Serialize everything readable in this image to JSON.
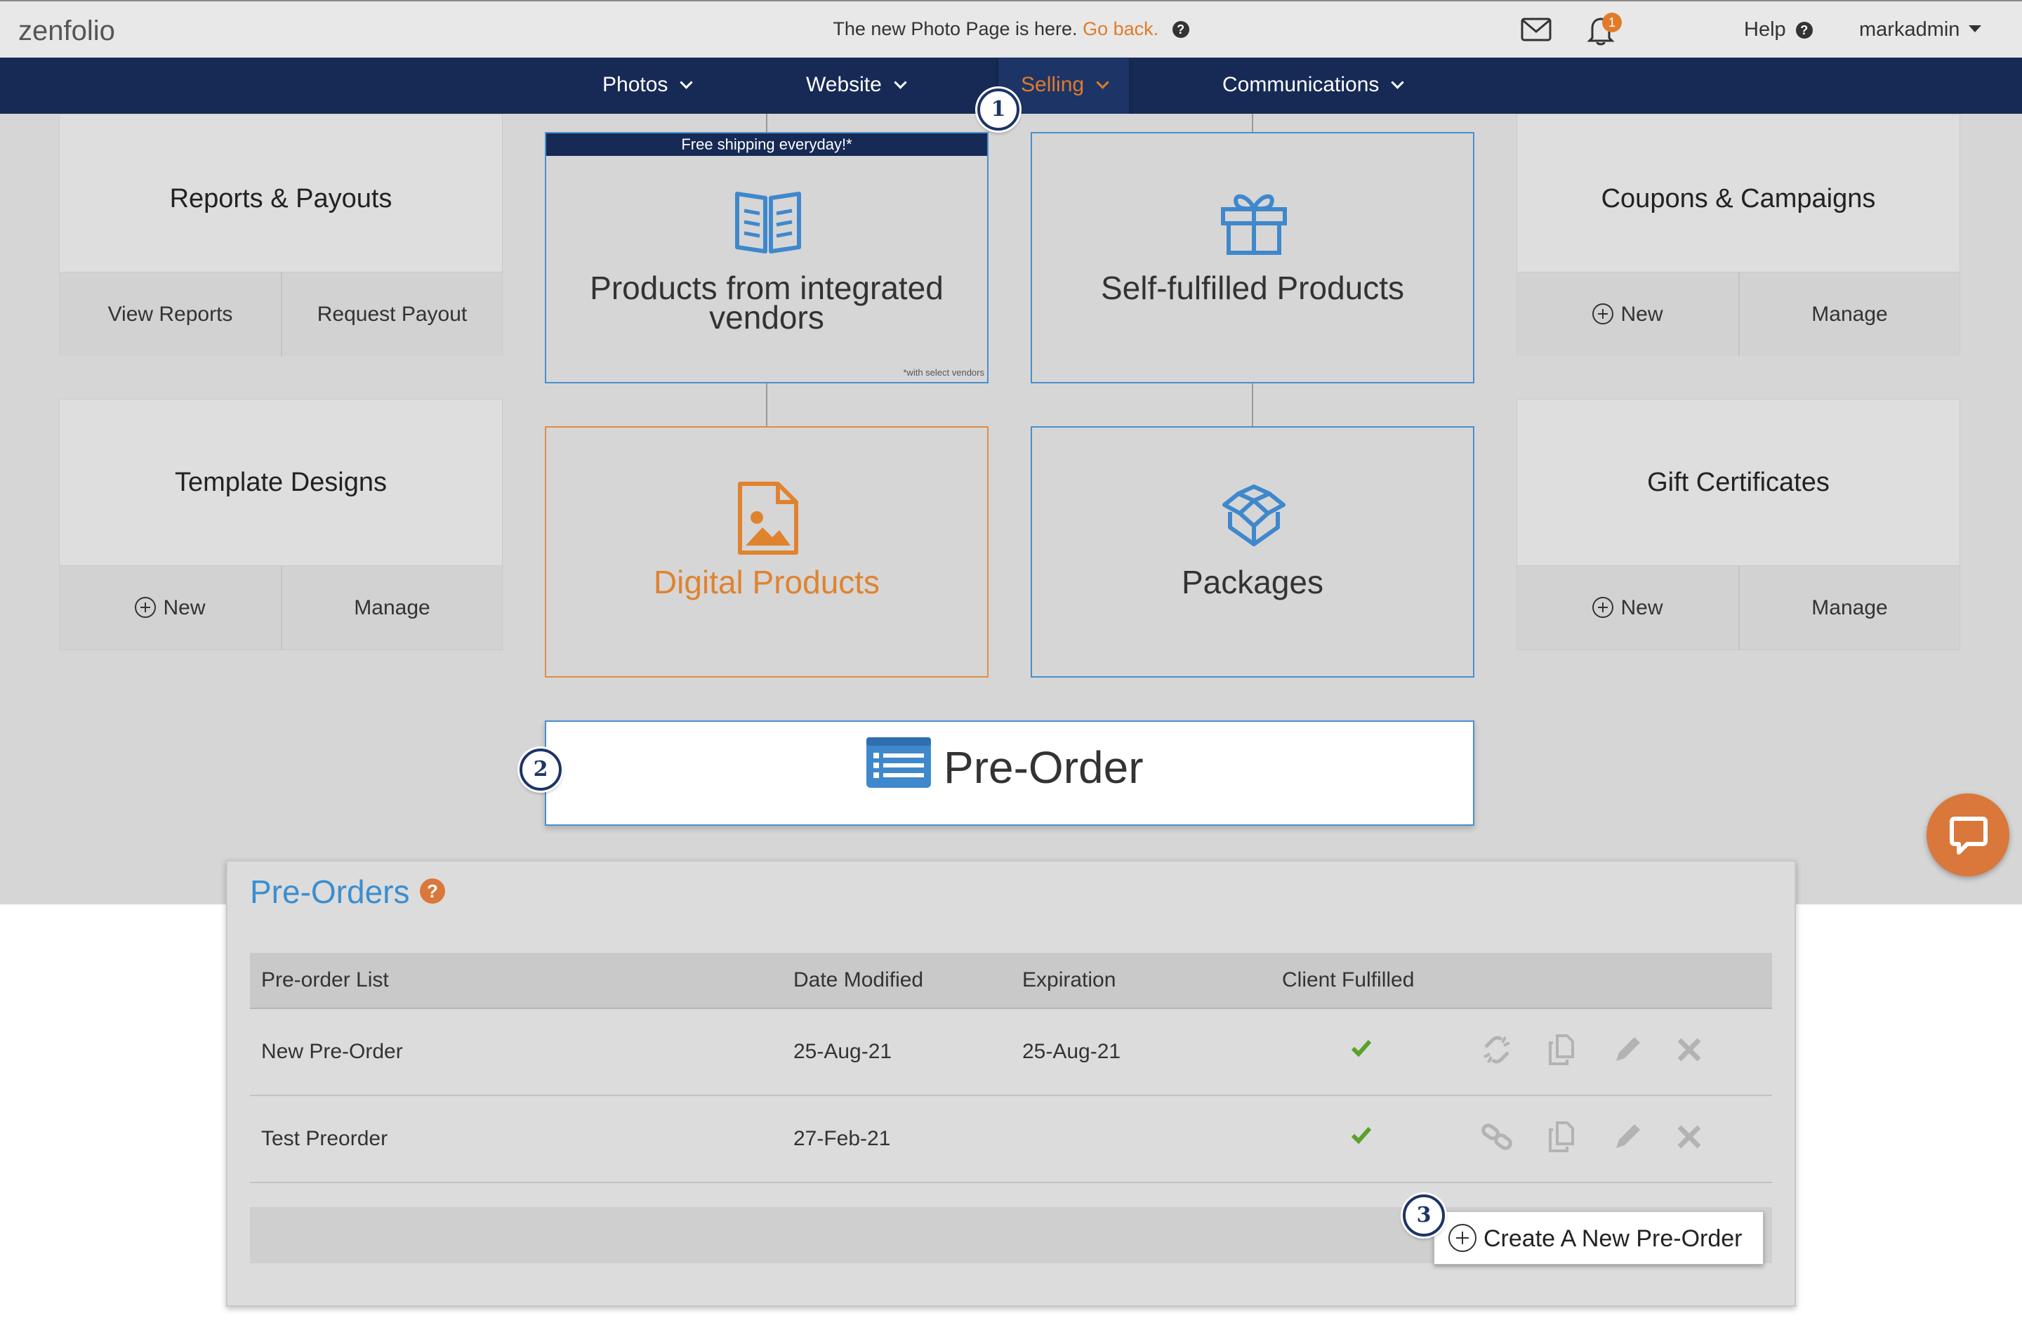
{
  "topbar": {
    "logo": "zenfolio",
    "notice_text": "The new Photo Page is here.",
    "notice_link": "Go back.",
    "bell_count": "1",
    "help_label": "Help",
    "user_label": "markadmin"
  },
  "nav": {
    "items": [
      {
        "label": "Photos"
      },
      {
        "label": "Website"
      },
      {
        "label": "Selling"
      },
      {
        "label": "Communications"
      }
    ],
    "active": "Selling"
  },
  "cards": {
    "reports": {
      "title": "Reports & Payouts",
      "left_btn": "View Reports",
      "right_btn": "Request Payout"
    },
    "templates": {
      "title": "Template Designs",
      "left_btn": "New",
      "right_btn": "Manage"
    },
    "coupons": {
      "title": "Coupons & Campaigns",
      "left_btn": "New",
      "right_btn": "Manage"
    },
    "gifts": {
      "title": "Gift Certificates",
      "left_btn": "New",
      "right_btn": "Manage"
    }
  },
  "tiles": {
    "integrated": {
      "banner": "Free shipping everyday!*",
      "line1": "Products from integrated",
      "line2": "vendors",
      "footnote": "*with select vendors"
    },
    "self": {
      "label": "Self-fulfilled Products"
    },
    "digital": {
      "label": "Digital Products"
    },
    "packages": {
      "label": "Packages"
    },
    "preorder": {
      "label": "Pre-Order"
    }
  },
  "steps": [
    "1",
    "2",
    "3"
  ],
  "panel": {
    "title": "Pre-Orders",
    "help_glyph": "?",
    "columns": [
      "Pre-order List",
      "Date Modified",
      "Expiration",
      "Client Fulfilled"
    ],
    "rows": [
      {
        "name": "New Pre-Order",
        "modified": "25-Aug-21",
        "expiration": "25-Aug-21",
        "client_fulfilled": true
      },
      {
        "name": "Test Preorder",
        "modified": "27-Feb-21",
        "expiration": "",
        "client_fulfilled": true
      }
    ],
    "create_label": "Create A New Pre-Order"
  },
  "colors": {
    "nav_bg": "#172a55",
    "accent_orange": "#e07b2a",
    "tile_blue": "#4a8fcf",
    "check_green": "#5aa02c",
    "panel_title_blue": "#3a8ed0"
  },
  "icons": [
    "mail-icon",
    "bell-icon",
    "book-icon",
    "gift-icon",
    "image-file-icon",
    "box-icon",
    "list-icon",
    "chat-icon",
    "link-icon",
    "copy-icon",
    "pencil-icon",
    "delete-icon",
    "check-icon",
    "plus-circle-icon",
    "chevron-down-icon"
  ]
}
